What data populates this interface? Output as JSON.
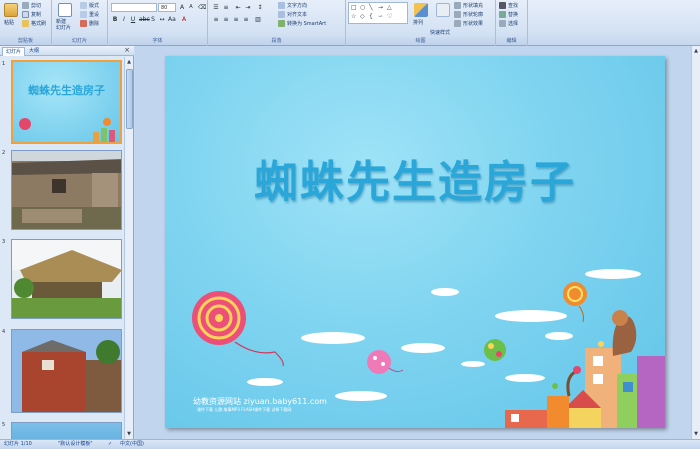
{
  "ribbon": {
    "clipboard": {
      "paste": "粘贴",
      "cut": "剪切",
      "copy": "复制",
      "format_painter": "格式刷",
      "label": "剪贴板"
    },
    "slides": {
      "new_slide": "新建\n幻灯片",
      "layout": "版式",
      "reset": "重设",
      "delete": "删除",
      "label": "幻灯片"
    },
    "font": {
      "font_name": "",
      "font_size": "80",
      "label": "字体"
    },
    "paragraph": {
      "text_direction": "文字方向",
      "align_text": "对齐文本",
      "convert_smartart": "转换为 SmartArt",
      "label": "段落"
    },
    "drawing": {
      "arrange": "排列",
      "quick_styles": "快速样式",
      "shape_fill": "形状填充",
      "shape_outline": "形状轮廓",
      "shape_effects": "形状效果",
      "label": "绘图"
    },
    "editing": {
      "find": "查找",
      "replace": "替换",
      "select": "选择",
      "label": "编辑"
    }
  },
  "panel": {
    "tabs": [
      "幻灯片",
      "大纲"
    ],
    "close": "×",
    "slide_numbers": [
      "1",
      "2",
      "3",
      "4",
      "5"
    ]
  },
  "slide": {
    "title": "蜘蛛先生造房子",
    "site": "幼教资源网站  ziyuan.baby611.com",
    "site_sub": "课件下载  儿歌  故事MP3  FLASH课件下载  试卷下载网",
    "thumb_title": "蜘蛛先生造房子"
  },
  "status": {
    "slide_count": "幻灯片 1/10",
    "theme": "\"默认设计模板\"",
    "language": "中文(中国)"
  },
  "colors": {
    "accent": "#2aa7d8",
    "selection": "#f0a03c",
    "ribbon_text": "#15428b"
  }
}
